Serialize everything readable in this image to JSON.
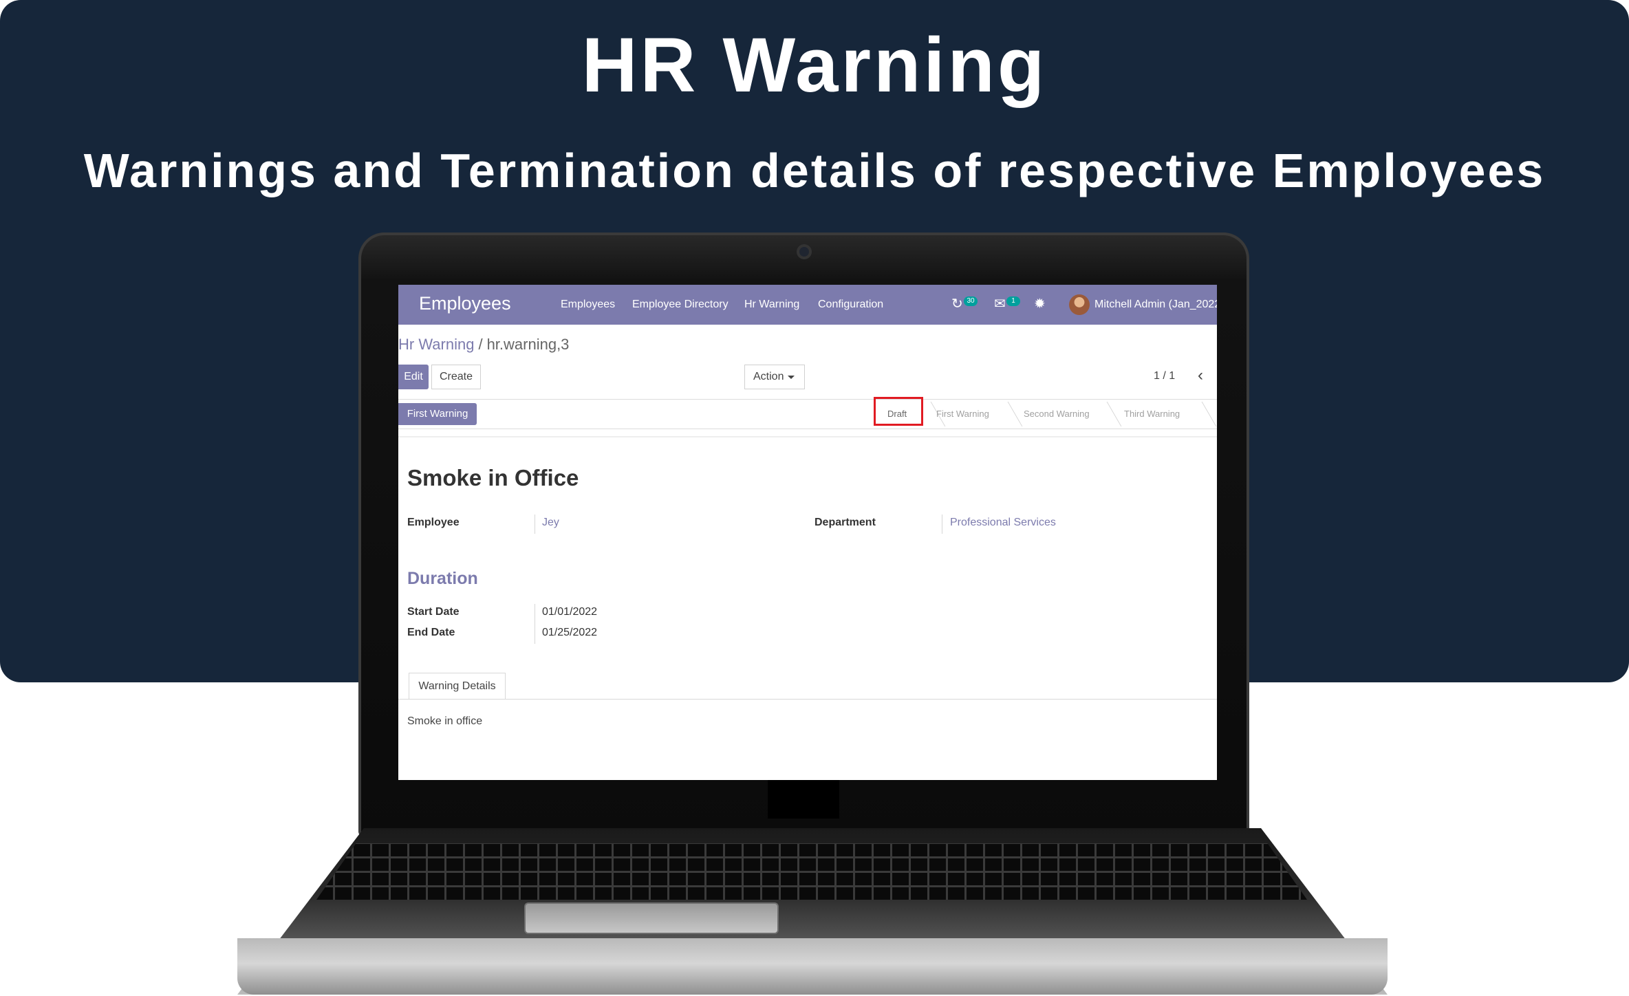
{
  "banner": {
    "title": "HR Warning",
    "subtitle": "Warnings and Termination details of respective Employees"
  },
  "navbar": {
    "brand": "Employees",
    "menu": [
      "Employees",
      "Employee Directory",
      "Hr Warning",
      "Configuration"
    ],
    "activity_count": "30",
    "message_count": "1",
    "user": "Mitchell Admin (Jan_2022)"
  },
  "breadcrumb": {
    "parent": "Hr Warning",
    "separator": "/",
    "current": "hr.warning,3"
  },
  "controls": {
    "edit": "Edit",
    "create": "Create",
    "action": "Action",
    "pager": "1 / 1"
  },
  "statusbar": {
    "button": "First Warning",
    "stages": [
      "Draft",
      "First Warning",
      "Second Warning",
      "Third Warning"
    ],
    "active_stage": "Draft"
  },
  "record": {
    "title": "Smoke in Office",
    "employee_label": "Employee",
    "employee_value": "Jey",
    "department_label": "Department",
    "department_value": "Professional Services",
    "duration_title": "Duration",
    "start_label": "Start Date",
    "start_value": "01/01/2022",
    "end_label": "End Date",
    "end_value": "01/25/2022"
  },
  "tabs": {
    "active": "Warning Details",
    "content": "Smoke in office"
  },
  "colors": {
    "banner_bg": "#16263a",
    "odoo_purple": "#7c7bad",
    "highlight": "#e11b22",
    "badge": "#00a09d"
  }
}
